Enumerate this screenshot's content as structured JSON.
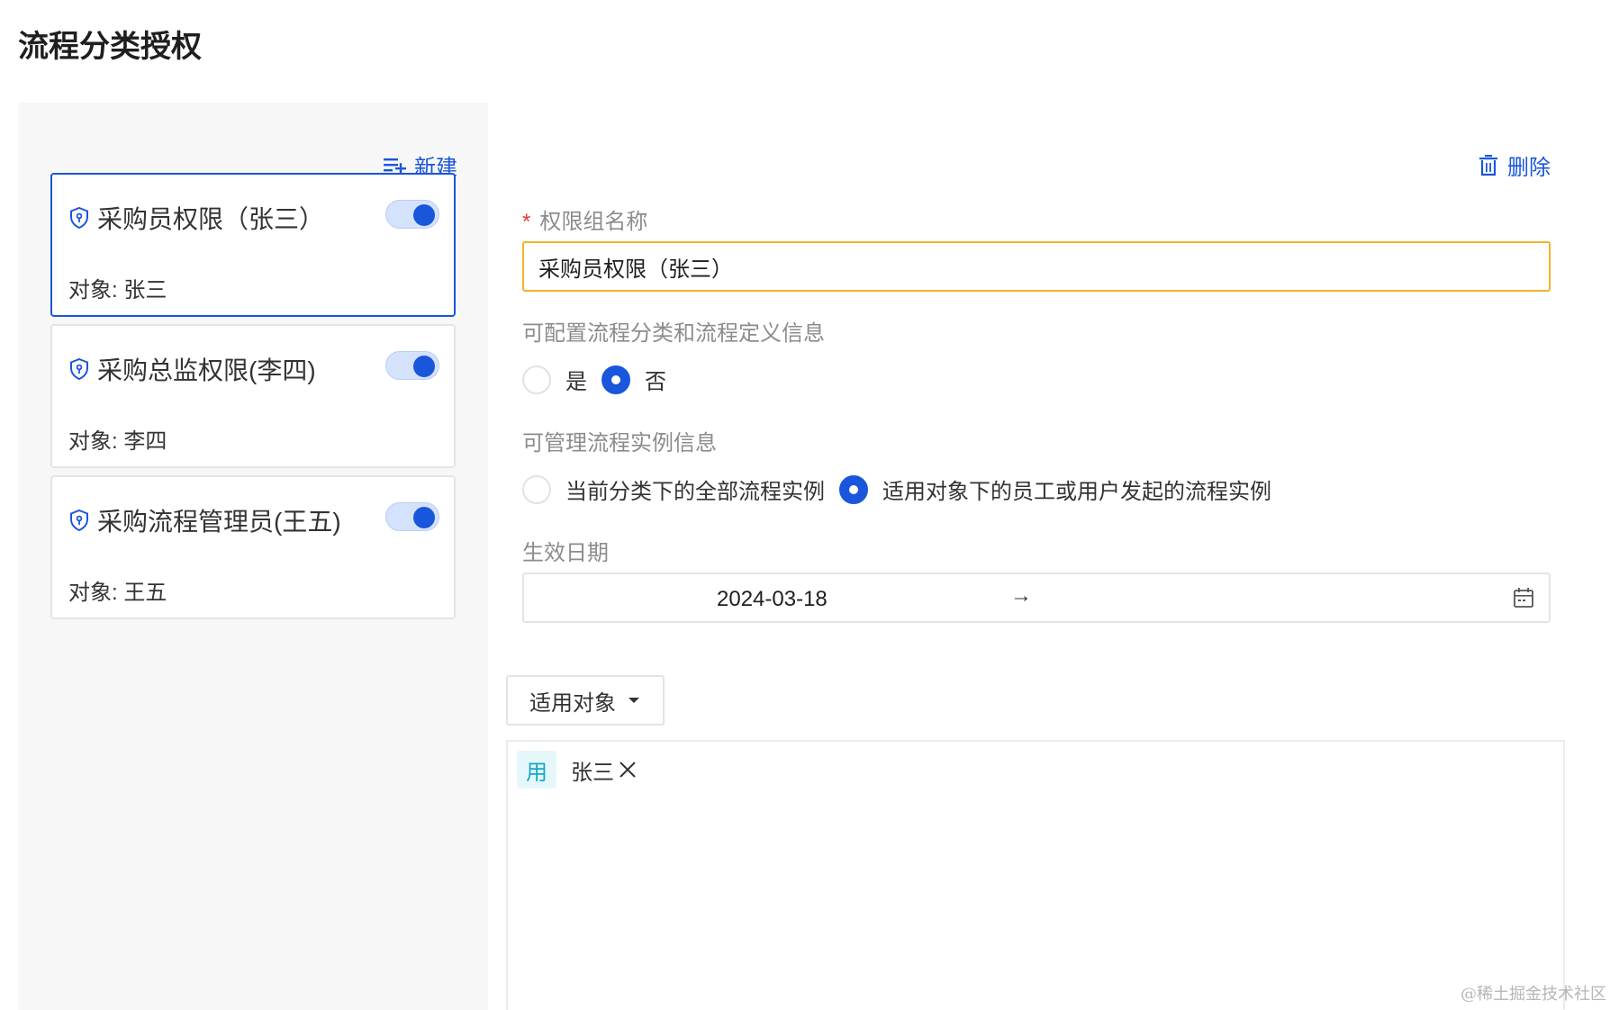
{
  "page_title": "流程分类授权",
  "sidebar": {
    "new_label": "新建",
    "groups": [
      {
        "name": "采购员权限（张三）",
        "target": "对象: 张三",
        "enabled": true,
        "selected": true
      },
      {
        "name": "采购总监权限(李四)",
        "target": "对象: 李四",
        "enabled": true,
        "selected": false
      },
      {
        "name": "采购流程管理员(王五)",
        "target": "对象: 王五",
        "enabled": true,
        "selected": false
      }
    ]
  },
  "detail": {
    "delete_label": "删除",
    "required_mark": "*",
    "name_label": "权限组名称",
    "name_value": "采购员权限（张三）",
    "config_label": "可配置流程分类和流程定义信息",
    "config_options": [
      "是",
      "否"
    ],
    "config_selected": "否",
    "manage_label": "可管理流程实例信息",
    "manage_options": [
      "当前分类下的全部流程实例",
      "适用对象下的员工或用户发起的流程实例"
    ],
    "manage_selected": "适用对象下的员工或用户发起的流程实例",
    "date_label": "生效日期",
    "date_start": "2024-03-18",
    "date_separator": "→",
    "date_end": "",
    "scope_dropdown_label": "适用对象",
    "scope_items": [
      {
        "type": "用",
        "name": "张三"
      }
    ]
  },
  "watermark": "@稀土掘金技术社区",
  "colors": {
    "primary": "#1a56db",
    "focus_border": "#f0b429",
    "required": "#e53935",
    "tag_bg": "#e6f7fb",
    "tag_text": "#13a8c8"
  }
}
